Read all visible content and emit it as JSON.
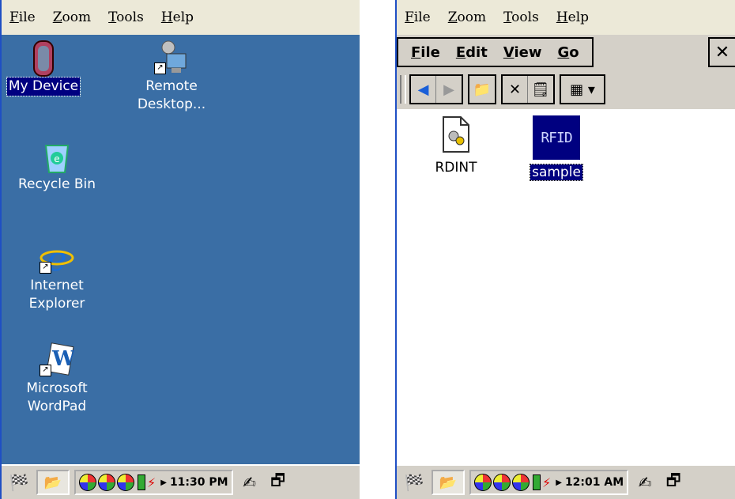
{
  "emulator_menu": [
    "File",
    "Zoom",
    "Tools",
    "Help"
  ],
  "left": {
    "desktop_icons": [
      {
        "name": "My Device",
        "icon": "my-device-icon",
        "selected": true
      },
      {
        "name": "Remote\nDesktop...",
        "icon": "remote-desktop-icon",
        "selected": false
      },
      {
        "name": "Recycle Bin",
        "icon": "recycle-bin-icon",
        "selected": false
      },
      {
        "name": "Internet\nExplorer",
        "icon": "internet-explorer-icon",
        "selected": false
      },
      {
        "name": "Microsoft\nWordPad",
        "icon": "wordpad-icon",
        "selected": false
      }
    ],
    "clock": "11:30 PM"
  },
  "right": {
    "app_menu": [
      "File",
      "Edit",
      "View",
      "Go"
    ],
    "files": [
      {
        "name": "RDINT",
        "icon": "settings-file-icon",
        "selected": false
      },
      {
        "name": "sample",
        "icon": "rfid-file-icon",
        "selected": true
      }
    ],
    "clock": "12:01 AM"
  },
  "colors": {
    "desktop": "#3a6ea5",
    "selection": "#000080",
    "taskbar": "#d4d0c8"
  }
}
